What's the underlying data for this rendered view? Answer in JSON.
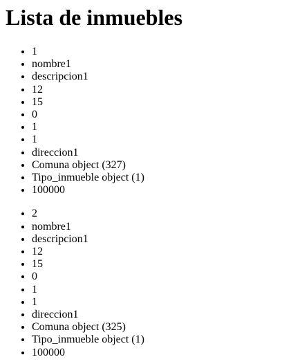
{
  "page": {
    "title": "Lista de inmuebles"
  },
  "inmuebles": [
    {
      "id": "1",
      "nombre": "nombre1",
      "descripcion": "descripcion1",
      "field_4": "12",
      "field_5": "15",
      "field_6": "0",
      "field_7": "1",
      "field_8": "1",
      "direccion": "direccion1",
      "comuna": "Comuna object (327)",
      "tipo_inmueble": "Tipo_inmueble object (1)",
      "precio": "100000"
    },
    {
      "id": "2",
      "nombre": "nombre1",
      "descripcion": "descripcion1",
      "field_4": "12",
      "field_5": "15",
      "field_6": "0",
      "field_7": "1",
      "field_8": "1",
      "direccion": "direccion1",
      "comuna": "Comuna object (325)",
      "tipo_inmueble": "Tipo_inmueble object (1)",
      "precio": "100000"
    }
  ]
}
